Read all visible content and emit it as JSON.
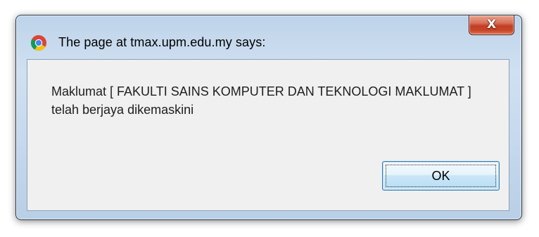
{
  "window": {
    "title": "The page at tmax.upm.edu.my says:",
    "app_icon": "chrome-icon",
    "close_button": {
      "glyph": "X",
      "icon": "close-icon"
    }
  },
  "dialog": {
    "message": "Maklumat [ FAKULTI SAINS KOMPUTER DAN TEKNOLOGI MAKLUMAT ] telah berjaya dikemaskini",
    "ok_button_label": "OK"
  },
  "colors": {
    "frame_glass": "#c6d9ed",
    "client_background": "#f0f0f0",
    "close_button_red": "#c8472a",
    "ok_button_border": "#3c7fb1"
  }
}
